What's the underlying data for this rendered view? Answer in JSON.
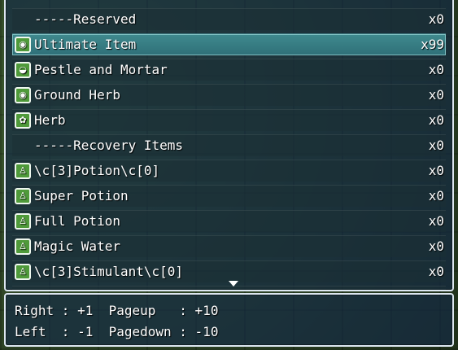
{
  "item_list": {
    "rows": [
      {
        "icon": "",
        "name": "-----Reserved",
        "qty": "x0",
        "category": true
      },
      {
        "icon": "ultimate-item-icon",
        "name": "Ultimate Item",
        "qty": "x99",
        "selected": true
      },
      {
        "icon": "pestle-and-mortar-icon",
        "name": "Pestle and Mortar",
        "qty": "x0"
      },
      {
        "icon": "ground-herb-icon",
        "name": "Ground Herb",
        "qty": "x0"
      },
      {
        "icon": "herb-icon",
        "name": "Herb",
        "qty": "x0"
      },
      {
        "icon": "",
        "name": "-----Recovery Items",
        "qty": "x0",
        "category": true
      },
      {
        "icon": "potion-icon",
        "name": "\\c[3]Potion\\c[0]",
        "qty": "x0"
      },
      {
        "icon": "potion-icon",
        "name": "Super Potion",
        "qty": "x0"
      },
      {
        "icon": "potion-icon",
        "name": "Full Potion",
        "qty": "x0"
      },
      {
        "icon": "potion-icon",
        "name": "Magic Water",
        "qty": "x0"
      },
      {
        "icon": "potion-icon",
        "name": "\\c[3]Stimulant\\c[0]",
        "qty": "x0"
      }
    ],
    "more_indicator": "down-arrow-icon"
  },
  "help": {
    "line1": "Right : +1  Pageup   : +10",
    "line2": "Left  : -1  Pagedown : -10"
  },
  "colors": {
    "window_border": "#dce6f0",
    "selection": "#3f8a8e",
    "icon_green": "#4f9a3a"
  }
}
